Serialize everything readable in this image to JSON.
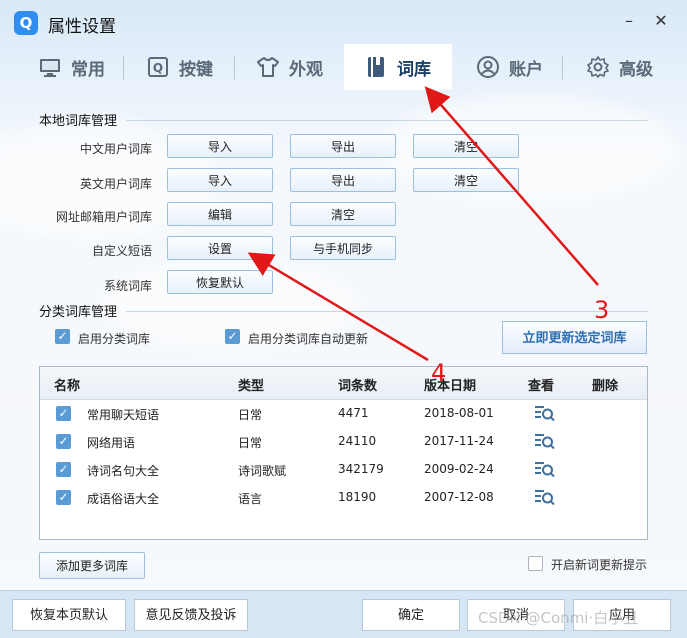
{
  "window": {
    "title": "属性设置",
    "logo_letter": "Q",
    "minimize_symbol": "–",
    "close_symbol": "✕"
  },
  "tabs": [
    {
      "label": "常用",
      "icon": "monitor-icon"
    },
    {
      "label": "按键",
      "icon": "key-q-icon"
    },
    {
      "label": "外观",
      "icon": "tshirt-icon"
    },
    {
      "label": "词库",
      "icon": "book-icon",
      "active": true
    },
    {
      "label": "账户",
      "icon": "user-icon"
    },
    {
      "label": "高级",
      "icon": "gear-icon"
    }
  ],
  "local": {
    "title": "本地词库管理",
    "rows": [
      {
        "label": "中文用户词库",
        "buttons": [
          "导入",
          "导出",
          "清空"
        ]
      },
      {
        "label": "英文用户词库",
        "buttons": [
          "导入",
          "导出",
          "清空"
        ]
      },
      {
        "label": "网址邮箱用户词库",
        "buttons": [
          "编辑",
          "清空"
        ]
      },
      {
        "label": "自定义短语",
        "buttons": [
          "设置",
          "与手机同步"
        ]
      },
      {
        "label": "系统词库",
        "buttons": [
          "恢复默认"
        ]
      }
    ]
  },
  "category": {
    "title": "分类词库管理",
    "enable_label": "启用分类词库",
    "auto_update_label": "启用分类词库自动更新",
    "update_button": "立即更新选定词库",
    "headers": [
      "名称",
      "类型",
      "词条数",
      "版本日期",
      "查看",
      "删除"
    ],
    "rows": [
      {
        "name": "常用聊天短语",
        "type": "日常",
        "count": "4471",
        "date": "2018-08-01"
      },
      {
        "name": "网络用语",
        "type": "日常",
        "count": "24110",
        "date": "2017-11-24"
      },
      {
        "name": "诗词名句大全",
        "type": "诗词歌赋",
        "count": "342179",
        "date": "2009-02-24"
      },
      {
        "name": "成语俗语大全",
        "type": "语言",
        "count": "18190",
        "date": "2007-12-08"
      }
    ],
    "add_more": "添加更多词库",
    "notify_label": "开启新词更新提示"
  },
  "footer": {
    "restore": "恢复本页默认",
    "feedback": "意见反馈及投诉",
    "ok": "确定",
    "cancel": "取消",
    "apply": "应用"
  },
  "annotations": {
    "marker_3": "3",
    "marker_4": "4"
  },
  "watermark": "CSDN @Conmi·白小丑",
  "colors": {
    "accent": "#2f6fb5",
    "checkbox": "#5b9bd5",
    "arrow": "#e01818"
  }
}
